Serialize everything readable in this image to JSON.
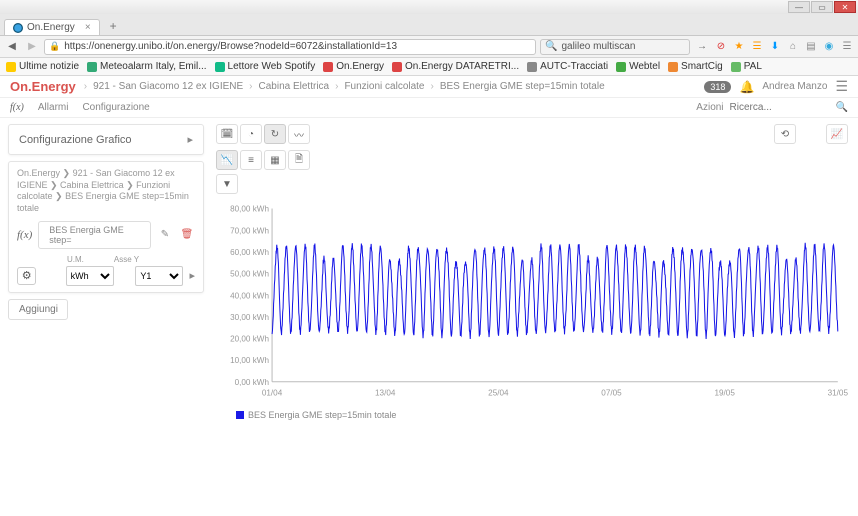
{
  "browser": {
    "tab_title": "On.Energy",
    "url": "https://onenergy.unibo.it/on.energy/Browse?nodeId=6072&installationId=13",
    "search_value": "galileo multiscan",
    "bookmarks": [
      "Ultime notizie",
      "Meteoalarm Italy, Emil...",
      "Lettore Web Spotify",
      "On.Energy",
      "On.Energy DATARETRI...",
      "AUTC-Tracciati",
      "Webtel",
      "SmartCig",
      "PAL"
    ]
  },
  "header": {
    "app_name": "On.Energy",
    "breadcrumb": [
      "921 - San Giacomo 12 ex IGIENE",
      "Cabina Elettrica",
      "Funzioni calcolate",
      "BES Energia GME step=15min totale"
    ],
    "badge": "318",
    "user": "Andrea Manzo"
  },
  "subheader": {
    "fx": "f(x)",
    "tabs": [
      "Allarmi",
      "Configurazione"
    ],
    "actions_label": "Azioni",
    "search_placeholder": "Ricerca..."
  },
  "sidebar": {
    "config_title": "Configurazione Grafico",
    "breadcrumb_text": "On.Energy ❯ 921 - San Giacomo 12 ex IGIENE ❯ Cabina Elettrica ❯ Funzioni calcolate ❯ BES Energia GME step=15min totale",
    "series_label": "BES Energia GME step=",
    "um_label": "U.M.",
    "axis_label": "Asse Y",
    "um_value": "kWh",
    "axis_value": "Y1",
    "add_label": "Aggiungi"
  },
  "chart_data": {
    "type": "line",
    "x_ticks": [
      "01/04",
      "13/04",
      "25/04",
      "07/05",
      "19/05",
      "31/05"
    ],
    "y_ticks": [
      "0,00 kWh",
      "10,00 kWh",
      "20,00 kWh",
      "30,00 kWh",
      "40,00 kWh",
      "50,00 kWh",
      "60,00 kWh",
      "70,00 kWh",
      "80,00 kWh"
    ],
    "ylim": [
      0,
      80
    ],
    "ylabel": "",
    "xlabel": "",
    "legend": "BES Energia GME step=15min totale",
    "series": [
      {
        "name": "BES Energia GME step=15min totale",
        "approx_daily_range": {
          "low": 22,
          "high": 62
        },
        "note": "15-minute energy readings 01/04–31/05; daily oscillation roughly 22–62 kWh with nightly baseline ~22–28 kWh and daytime peaks 55–68 kWh"
      }
    ]
  }
}
